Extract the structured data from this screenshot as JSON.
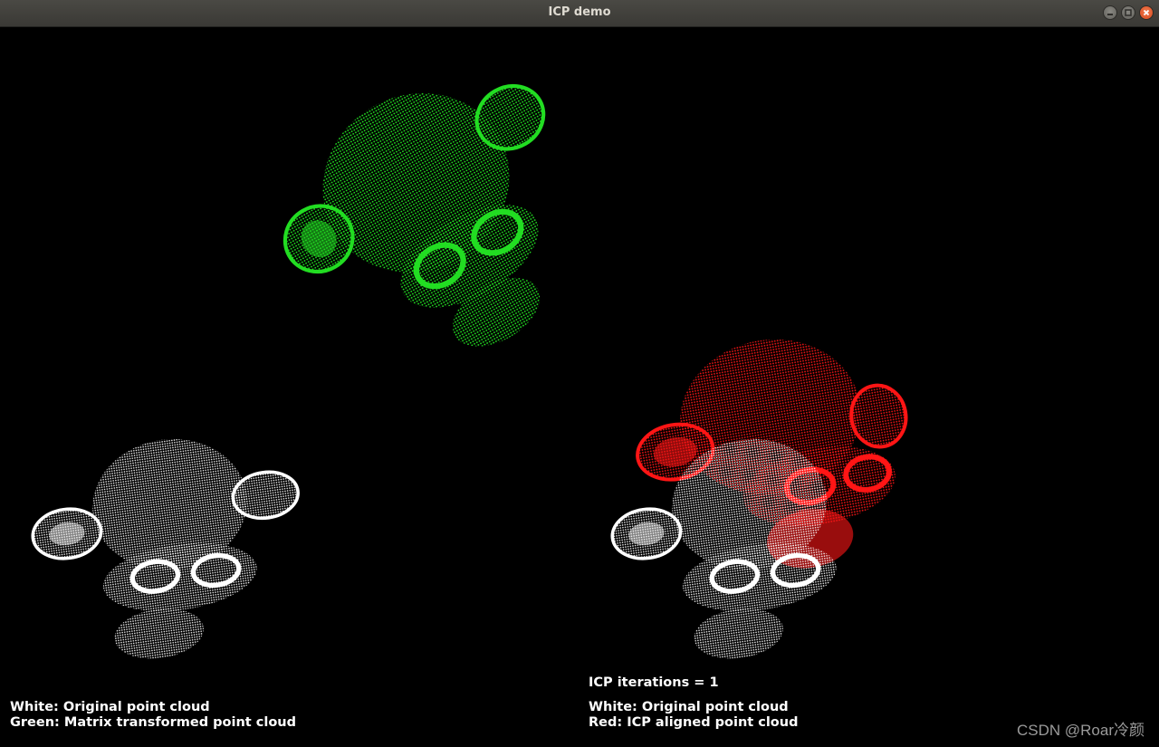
{
  "window": {
    "title": "ICP demo"
  },
  "left_view": {
    "legend_white": "White: Original point cloud",
    "legend_green": "Green: Matrix transformed point cloud"
  },
  "right_view": {
    "iterations_label": "ICP iterations = 1",
    "legend_white": "White: Original point cloud",
    "legend_red": "Red: ICP aligned point cloud"
  },
  "colors": {
    "background": "#000000",
    "original_cloud": "#ffffff",
    "transformed_cloud": "#22dd22",
    "aligned_cloud": "#ff1515"
  },
  "watermark": "CSDN @Roar冷颜"
}
